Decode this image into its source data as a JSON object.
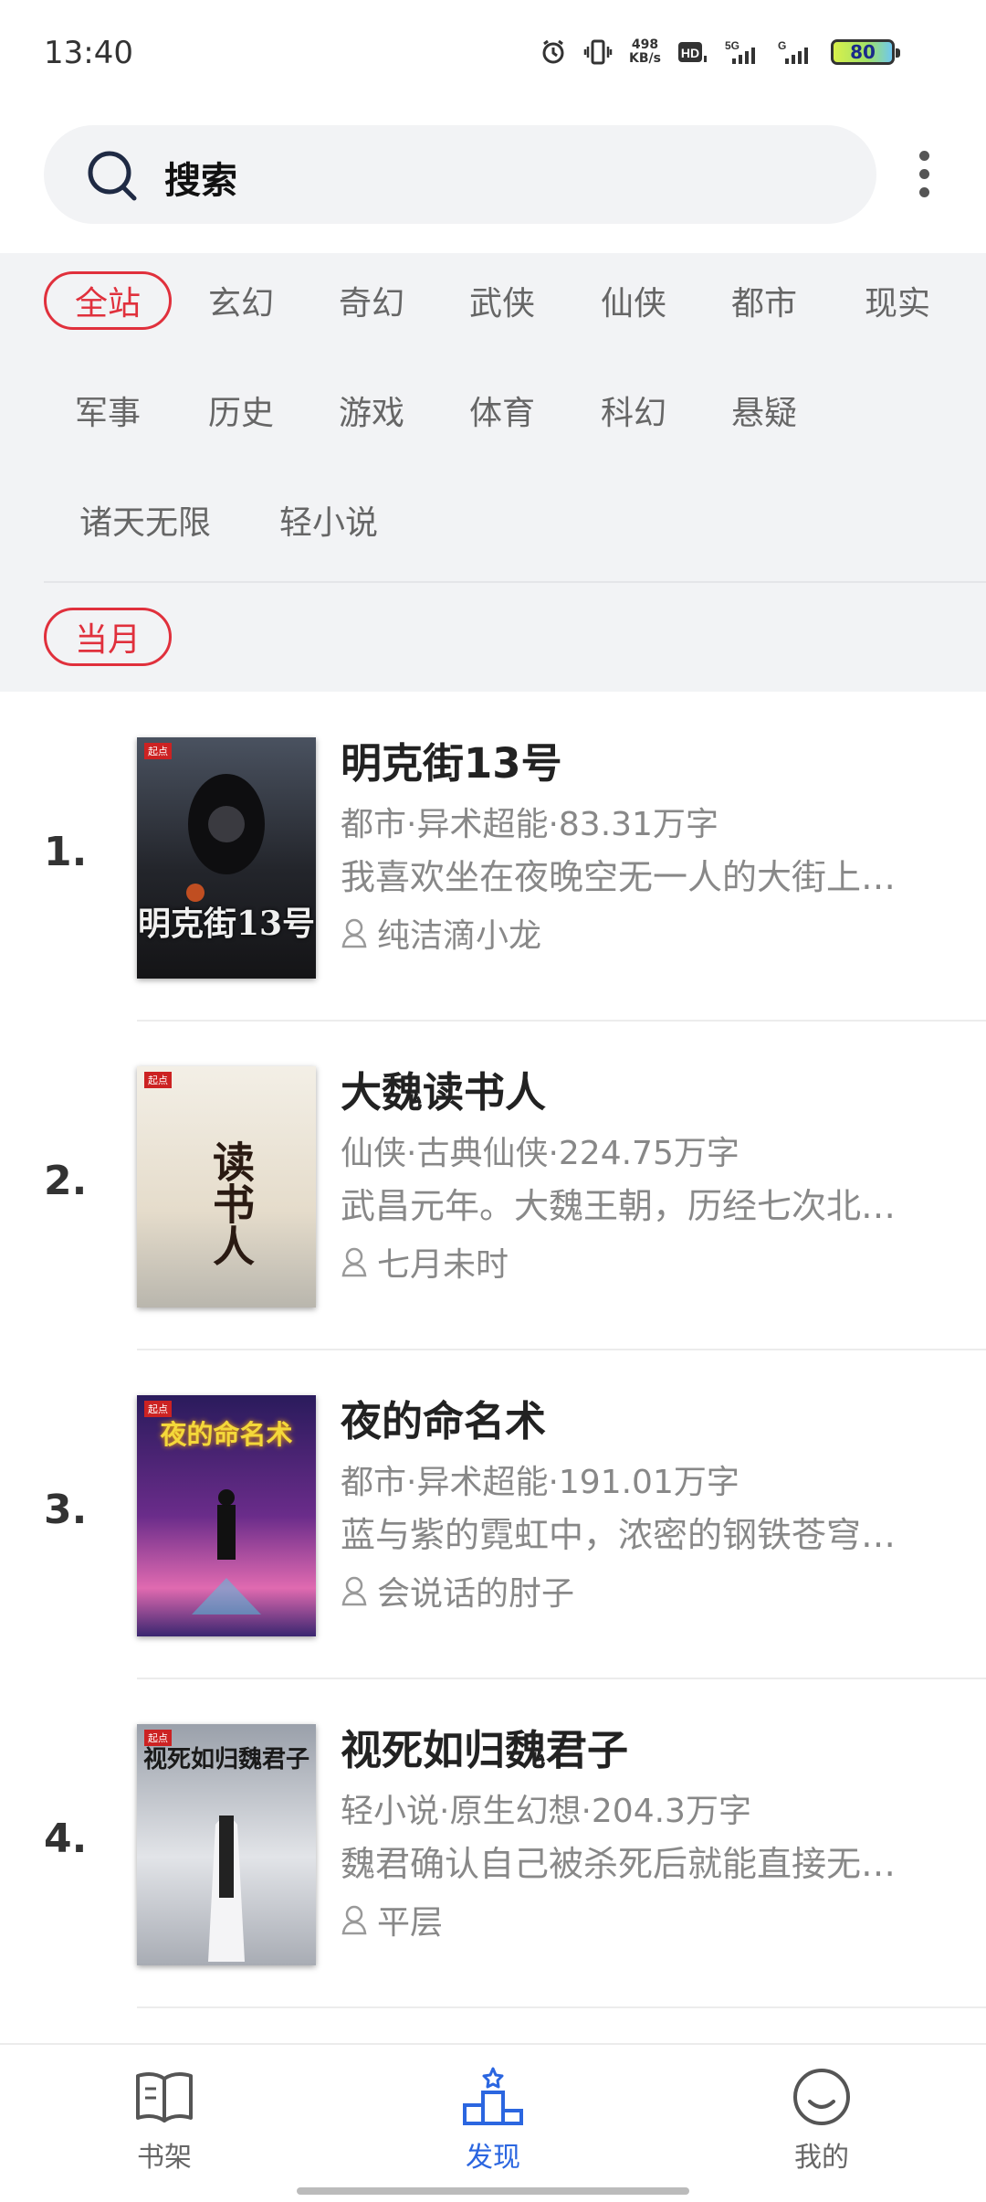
{
  "status_bar": {
    "time": "13:40",
    "speed_value": "498",
    "speed_unit": "KB/s",
    "battery": "80",
    "icons": [
      "alarm-icon",
      "vibrate-icon",
      "hd-icon",
      "signal-5g-icon",
      "signal-g-icon",
      "battery-icon"
    ]
  },
  "search": {
    "placeholder": "搜索"
  },
  "categories": {
    "rows": [
      [
        "全站",
        "玄幻",
        "奇幻",
        "武侠",
        "仙侠",
        "都市",
        "现实"
      ],
      [
        "军事",
        "历史",
        "游戏",
        "体育",
        "科幻",
        "悬疑"
      ],
      [
        "诸天无限",
        "轻小说"
      ]
    ],
    "active": "全站"
  },
  "period": {
    "label": "当月"
  },
  "books": [
    {
      "rank": "1.",
      "title": "明克街13号",
      "meta": "都市·异术超能·83.31万字",
      "desc": "我喜欢坐在夜晚空无一人的大街上…",
      "author": "纯洁滴小龙",
      "cover_text": "明克街13号",
      "cover_bg": "#2a2c33"
    },
    {
      "rank": "2.",
      "title": "大魏读书人",
      "meta": "仙侠·古典仙侠·224.75万字",
      "desc": "武昌元年。大魏王朝，历经七次北…",
      "author": "七月未时",
      "cover_text": "读书人",
      "cover_bg": "#e9e4d8"
    },
    {
      "rank": "3.",
      "title": "夜的命名术",
      "meta": "都市·异术超能·191.01万字",
      "desc": "蓝与紫的霓虹中，浓密的钢铁苍穹…",
      "author": "会说话的肘子",
      "cover_text": "夜的命名术",
      "cover_bg": "#3b2370"
    },
    {
      "rank": "4.",
      "title": "视死如归魏君子",
      "meta": "轻小说·原生幻想·204.3万字",
      "desc": "魏君确认自己被杀死后就能直接无…",
      "author": "平层",
      "cover_text": "视死如归魏君子",
      "cover_bg": "#c9ccd2"
    }
  ],
  "bottom_nav": [
    {
      "label": "书架",
      "icon": "book-icon",
      "active": false
    },
    {
      "label": "发现",
      "icon": "discover-icon",
      "active": true
    },
    {
      "label": "我的",
      "icon": "profile-smile-icon",
      "active": false
    }
  ],
  "colors": {
    "accent_red": "#e0303c",
    "accent_blue": "#2b66e0",
    "panel_bg": "#f2f3f5"
  }
}
